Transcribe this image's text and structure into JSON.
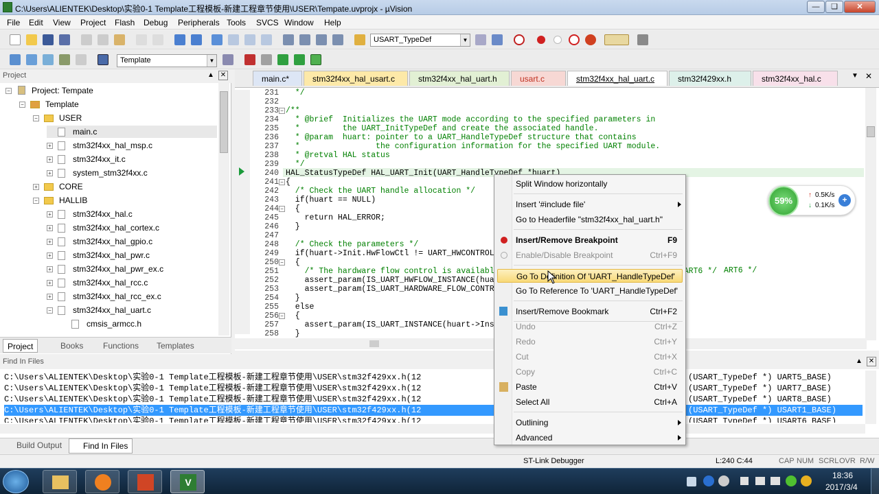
{
  "window": {
    "title": "C:\\Users\\ALIENTEK\\Desktop\\实验0-1 Template工程模板-新建工程章节使用\\USER\\Tempate.uvprojx - µVision"
  },
  "menu": [
    "File",
    "Edit",
    "View",
    "Project",
    "Flash",
    "Debug",
    "Peripherals",
    "Tools",
    "SVCS",
    "Window",
    "Help"
  ],
  "toolbar": {
    "find_combo": "USART_TypeDef",
    "target_combo": "Template"
  },
  "project": {
    "header": "Project",
    "root": "Project: Tempate",
    "target": "Template",
    "user_folder": "USER",
    "user_files": [
      "main.c",
      "stm32f4xx_hal_msp.c",
      "stm32f4xx_it.c",
      "system_stm32f4xx.c"
    ],
    "core_folder": "CORE",
    "hallib_folder": "HALLIB",
    "hallib_files": [
      "stm32f4xx_hal.c",
      "stm32f4xx_hal_cortex.c",
      "stm32f4xx_hal_gpio.c",
      "stm32f4xx_hal_pwr.c",
      "stm32f4xx_hal_pwr_ex.c",
      "stm32f4xx_hal_rcc.c",
      "stm32f4xx_hal_rcc_ex.c",
      "stm32f4xx_hal_uart.c"
    ],
    "sub_file": "cmsis_armcc.h",
    "tabs": [
      "Project",
      "Books",
      "Functions",
      "Templates"
    ]
  },
  "editor": {
    "tabs": [
      "main.c*",
      "stm32f4xx_hal_usart.c",
      "stm32f4xx_hal_uart.h",
      "usart.c",
      "stm32f4xx_hal_uart.c",
      "stm32f429xx.h",
      "stm32f4xx_hal.c"
    ],
    "line_numbers": [
      "231",
      "232",
      "233",
      "234",
      "235",
      "236",
      "237",
      "238",
      "239",
      "240",
      "241",
      "242",
      "243",
      "244",
      "245",
      "246",
      "247",
      "248",
      "249",
      "250",
      "251",
      "252",
      "253",
      "254",
      "255",
      "256",
      "257",
      "258"
    ],
    "lines": [
      "  */",
      "",
      "/**",
      "  * @brief  Initializes the UART mode according to the specified parameters in",
      "  *         the UART_InitTypeDef and create the associated handle.",
      "  * @param  huart: pointer to a UART_HandleTypeDef structure that contains",
      "  *                the configuration information for the specified UART module.",
      "  * @retval HAL status",
      "  */",
      "HAL_StatusTypeDef HAL_UART_Init(UART_HandleTypeDef *huart)",
      "{",
      "  /* Check the UART handle allocation */",
      "  if(huart == NULL)",
      "  {",
      "    return HAL_ERROR;",
      "  }",
      "",
      "  /* Check the parameters */",
      "  if(huart->Init.HwFlowCtl != UART_HWCONTROL_NONE)",
      "  {",
      "    /* The hardware flow control is available only for USART1, USART2, USART3 and USART6 */",
      "    assert_param(IS_UART_HWFLOW_INSTANCE(huart->Instance));",
      "    assert_param(IS_UART_HARDWARE_FLOW_CONTROL(huart->Init.HwFlowCtl));",
      "  }",
      "  else",
      "  {",
      "    assert_param(IS_UART_INSTANCE(huart->Instance));",
      "  }"
    ],
    "tail_text": "ART6 */"
  },
  "find": {
    "header": "Find In Files",
    "rows": [
      "C:\\Users\\ALIENTEK\\Desktop\\实验0-1 Template工程模板-新建工程章节使用\\USER\\stm32f429xx.h(12",
      "C:\\Users\\ALIENTEK\\Desktop\\实验0-1 Template工程模板-新建工程章节使用\\USER\\stm32f429xx.h(12",
      "C:\\Users\\ALIENTEK\\Desktop\\实验0-1 Template工程模板-新建工程章节使用\\USER\\stm32f429xx.h(12",
      "C:\\Users\\ALIENTEK\\Desktop\\实验0-1 Template工程模板-新建工程章节使用\\USER\\stm32f429xx.h(12",
      "C:\\Users\\ALIENTEK\\Desktop\\实验0-1 Template工程模板-新建工程章节使用\\USER\\stm32f429xx.h(12"
    ],
    "rows_right": [
      "(USART_TypeDef *) UART5_BASE)",
      "(USART_TypeDef *) UART7_BASE)",
      "(USART_TypeDef *) UART8_BASE)",
      "(USART_TypeDef *) USART1_BASE)",
      "(USART_TypeDef *) USART6_BASE)"
    ],
    "tabs": [
      "Build Output",
      "Find In Files"
    ]
  },
  "context_menu": {
    "items": [
      {
        "label": "Split Window horizontally",
        "shortcut": ""
      },
      {
        "label": "Insert '#include file'",
        "shortcut": ""
      },
      {
        "label": "Go to Headerfile \"stm32f4xx_hal_uart.h\"",
        "shortcut": ""
      },
      {
        "label": "Insert/Remove Breakpoint",
        "shortcut": "F9"
      },
      {
        "label": "Enable/Disable Breakpoint",
        "shortcut": "Ctrl+F9"
      },
      {
        "label": "Go To Definition Of 'UART_HandleTypeDef'",
        "shortcut": ""
      },
      {
        "label": "Go To Reference To 'UART_HandleTypeDef'",
        "shortcut": ""
      },
      {
        "label": "Insert/Remove Bookmark",
        "shortcut": "Ctrl+F2"
      },
      {
        "label": "Undo",
        "shortcut": "Ctrl+Z"
      },
      {
        "label": "Redo",
        "shortcut": "Ctrl+Y"
      },
      {
        "label": "Cut",
        "shortcut": "Ctrl+X"
      },
      {
        "label": "Copy",
        "shortcut": "Ctrl+C"
      },
      {
        "label": "Paste",
        "shortcut": "Ctrl+V"
      },
      {
        "label": "Select All",
        "shortcut": "Ctrl+A"
      },
      {
        "label": "Outlining",
        "shortcut": ""
      },
      {
        "label": "Advanced",
        "shortcut": ""
      }
    ]
  },
  "netmeter": {
    "percent": "59%",
    "up": "0.5K/s",
    "down": "0.1K/s"
  },
  "status": {
    "debugger": "ST-Link Debugger",
    "position": "L:240 C:44",
    "indicators": [
      "CAP",
      "NUM",
      "SCRL",
      "OVR",
      "R/W"
    ]
  },
  "taskbar": {
    "time": "18:36",
    "date": "2017/3/4"
  }
}
